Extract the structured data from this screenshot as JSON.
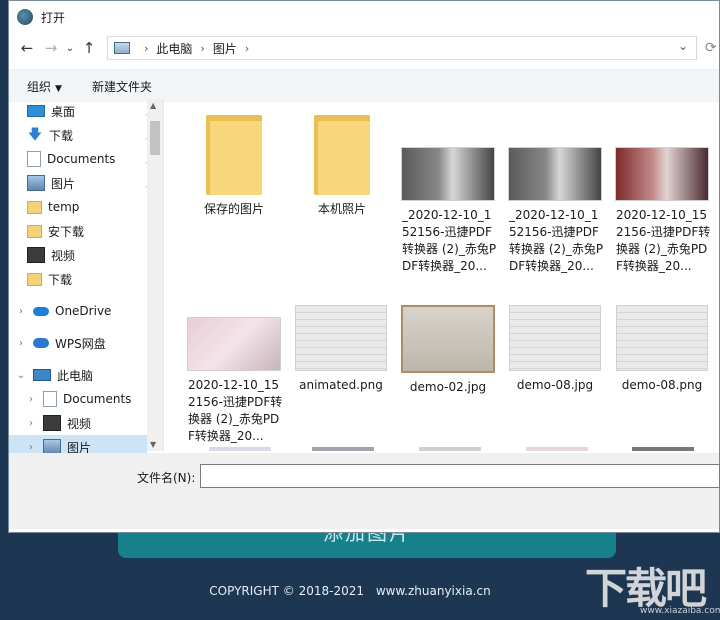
{
  "dialog": {
    "title": "打开"
  },
  "address": {
    "crumbs": [
      "此电脑",
      "图片"
    ]
  },
  "toolbar": {
    "organize": "组织",
    "new_folder": "新建文件夹"
  },
  "sidebar": {
    "items": [
      {
        "label": "桌面",
        "icon": "desktop-icon"
      },
      {
        "label": "下载",
        "icon": "download-icon"
      },
      {
        "label": "Documents",
        "icon": "document-icon"
      },
      {
        "label": "图片",
        "icon": "pictures-icon"
      },
      {
        "label": "temp",
        "icon": "folder-icon"
      },
      {
        "label": "安下载",
        "icon": "folder-icon"
      },
      {
        "label": "视频",
        "icon": "video-icon"
      },
      {
        "label": "下载",
        "icon": "folder-icon"
      },
      {
        "label": "OneDrive",
        "icon": "cloud-icon"
      },
      {
        "label": "WPS网盘",
        "icon": "wps-cloud-icon"
      },
      {
        "label": "此电脑",
        "icon": "computer-icon"
      },
      {
        "label": "Documents",
        "icon": "document-icon"
      },
      {
        "label": "视频",
        "icon": "video-icon"
      },
      {
        "label": "图片",
        "icon": "pictures-icon"
      }
    ]
  },
  "files": [
    {
      "label": "保存的图片"
    },
    {
      "label": "本机照片"
    },
    {
      "label": "_2020-12-10_152156-迅捷PDF转换器 (2)_赤兔PDF转换器_20..."
    },
    {
      "label": "_2020-12-10_152156-迅捷PDF转换器 (2)_赤兔PDF转换器_20..."
    },
    {
      "label": "2020-12-10_152156-迅捷PDF转换器 (2)_赤兔PDF转换器_20..."
    },
    {
      "label": "2020-12-10_152156-迅捷PDF转换器 (2)_赤兔PDF转换器_20..."
    },
    {
      "label": "animated.png"
    },
    {
      "label": "demo-02.jpg"
    },
    {
      "label": "demo-08.jpg"
    },
    {
      "label": "demo-08.png"
    }
  ],
  "filename": {
    "label": "文件名(N):",
    "value": ""
  },
  "background": {
    "button": "添加图片",
    "copyright": "COPYRIGHT © 2018-2021",
    "site": "www.zhuanyixia.cn",
    "watermark": "下载吧",
    "watermark_sub": "www.xiazaiba.com"
  }
}
